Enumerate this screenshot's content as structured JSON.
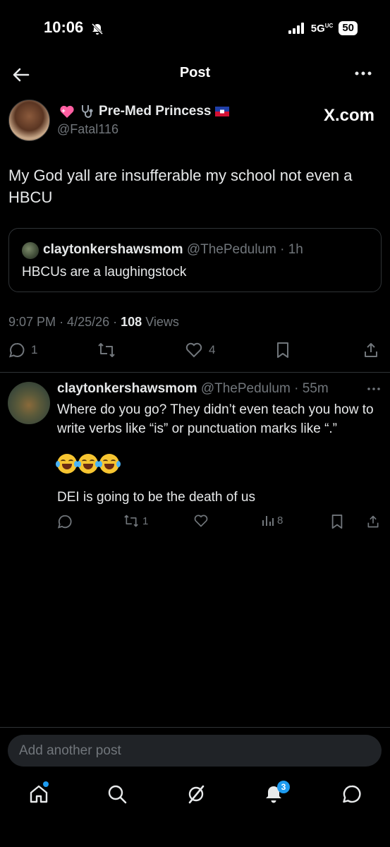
{
  "status_bar": {
    "time": "10:06",
    "network": "5G",
    "network_sup": "UC",
    "battery": "50"
  },
  "header": {
    "title": "Post"
  },
  "post": {
    "author_name": "Pre-Med Princess",
    "author_handle": "@Fatal116",
    "source_label": "X.com",
    "text": "My God yall are insufferable my school not even a HBCU",
    "quote": {
      "name": "claytonkershawsmom",
      "handle": "@ThePedulum",
      "age": "· 1h",
      "text": "HBCUs are a laughingstock"
    },
    "time": "9:07 PM",
    "date": "· 4/25/26 ·",
    "views_count": "108",
    "views_label": "Views",
    "replies": "1",
    "likes": "4"
  },
  "reply": {
    "name": "claytonkershawsmom",
    "handle": "@ThePedulum",
    "age": "· 55m",
    "text": "Where do you go? They didn’t even teach you how to write verbs like “is” or punctuation marks like “.”",
    "text2": "DEI is going to be the death of us",
    "reposts": "1",
    "views": "8"
  },
  "composer": {
    "placeholder": "Add another post"
  },
  "nav": {
    "notifications_badge": "3"
  },
  "colors": {
    "background": "#000000",
    "text": "#e7e9ea",
    "muted": "#71767b",
    "accent": "#1d9bf0",
    "border": "#2f3336"
  }
}
